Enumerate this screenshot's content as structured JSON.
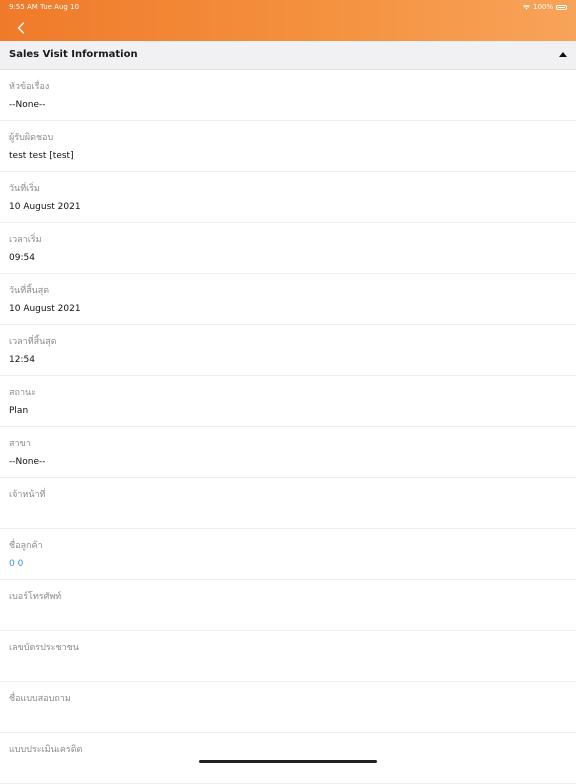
{
  "status_bar": {
    "time_date": "9:55 AM   Tue Aug 10",
    "battery": "100%"
  },
  "section": {
    "title": "Sales Visit Information"
  },
  "fields": [
    {
      "label": "หัวข้อเรื่อง",
      "value": "--None--"
    },
    {
      "label": "ผู้รับผิดชอบ",
      "value": "test test [test]"
    },
    {
      "label": "วันที่เริ่ม",
      "value": "10 August 2021"
    },
    {
      "label": "เวลาเริ่ม",
      "value": "09:54"
    },
    {
      "label": "วันที่สิ้นสุด",
      "value": "10 August 2021"
    },
    {
      "label": "เวลาที่สิ้นสุด",
      "value": "12:54"
    },
    {
      "label": "สถานะ",
      "value": "Plan"
    },
    {
      "label": "สาขา",
      "value": "--None--"
    },
    {
      "label": "เจ้าหน้าที่",
      "value": ""
    },
    {
      "label": "ชื่อลูกค้า",
      "value": "0 0"
    },
    {
      "label": "เบอร์โทรศัพท์",
      "value": ""
    },
    {
      "label": "เลขบัตรประชาชน",
      "value": ""
    },
    {
      "label": "ชื่อแบบสอบถาม",
      "value": ""
    },
    {
      "label": "แบบประเมินเครดิต",
      "value": ""
    }
  ],
  "colors": {
    "header_start": "#ef7a2a",
    "header_end": "#f8a35a",
    "link": "#3b8fd8"
  },
  "icons": {
    "back": "chevron-left-icon",
    "collapse": "caret-up-icon"
  }
}
